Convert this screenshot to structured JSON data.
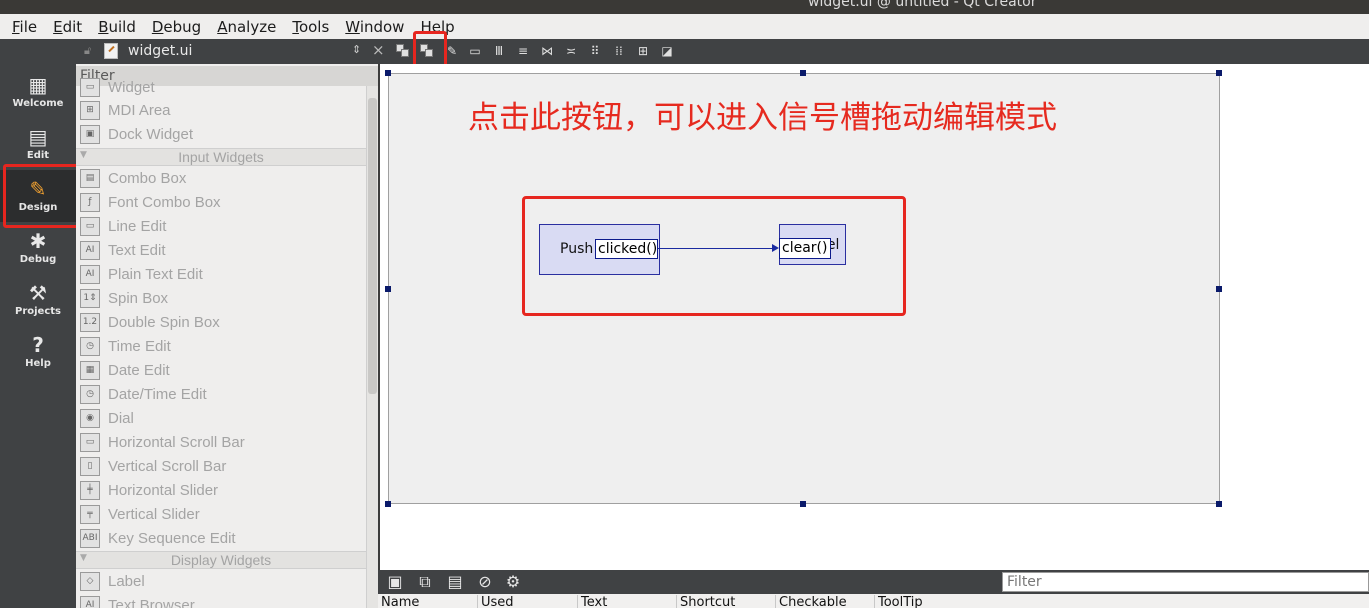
{
  "window": {
    "title": "widget.ui @ untitled - Qt Creator"
  },
  "menu": [
    {
      "mn": "F",
      "rest": "ile"
    },
    {
      "mn": "E",
      "rest": "dit"
    },
    {
      "mn": "B",
      "rest": "uild"
    },
    {
      "mn": "D",
      "rest": "ebug"
    },
    {
      "mn": "A",
      "rest": "nalyze"
    },
    {
      "mn": "T",
      "rest": "ools"
    },
    {
      "mn": "W",
      "rest": "indow"
    },
    {
      "mn": "H",
      "rest": "elp"
    }
  ],
  "modes": [
    {
      "label": "Welcome",
      "icon": "grid-icon"
    },
    {
      "label": "Edit",
      "icon": "document-icon"
    },
    {
      "label": "Design",
      "icon": "pencil-icon",
      "active": true
    },
    {
      "label": "Debug",
      "icon": "bug-icon"
    },
    {
      "label": "Projects",
      "icon": "wrench-icon"
    },
    {
      "label": "Help",
      "icon": "help-icon"
    }
  ],
  "document": {
    "filename": "widget.ui"
  },
  "widget_box": {
    "filter_placeholder": "Filter",
    "partial_top_item": "Widget",
    "items_containers": [
      "MDI Area",
      "Dock Widget"
    ],
    "category_input": "Input Widgets",
    "items_input": [
      "Combo Box",
      "Font Combo Box",
      "Line Edit",
      "Text Edit",
      "Plain Text Edit",
      "Spin Box",
      "Double Spin Box",
      "Time Edit",
      "Date Edit",
      "Date/Time Edit",
      "Dial",
      "Horizontal Scroll Bar",
      "Vertical Scroll Bar",
      "Horizontal Slider",
      "Vertical Slider",
      "Key Sequence Edit"
    ],
    "category_display": "Display Widgets",
    "items_display": [
      "Label",
      "Text Browser"
    ]
  },
  "form": {
    "annotation": "点击此按钮，可以进入信号槽拖动编辑模式",
    "push_button_text": "Push",
    "signal": "clicked()",
    "label_text": "bel",
    "slot": "clear()"
  },
  "action_editor": {
    "filter_placeholder": "Filter",
    "columns": [
      "Name",
      "Used",
      "Text",
      "Shortcut",
      "Checkable",
      "ToolTip"
    ]
  },
  "colors": {
    "annotation_red": "#e62a1f",
    "design_accent": "#f0a030",
    "connection_blue": "#1a2aa0"
  }
}
